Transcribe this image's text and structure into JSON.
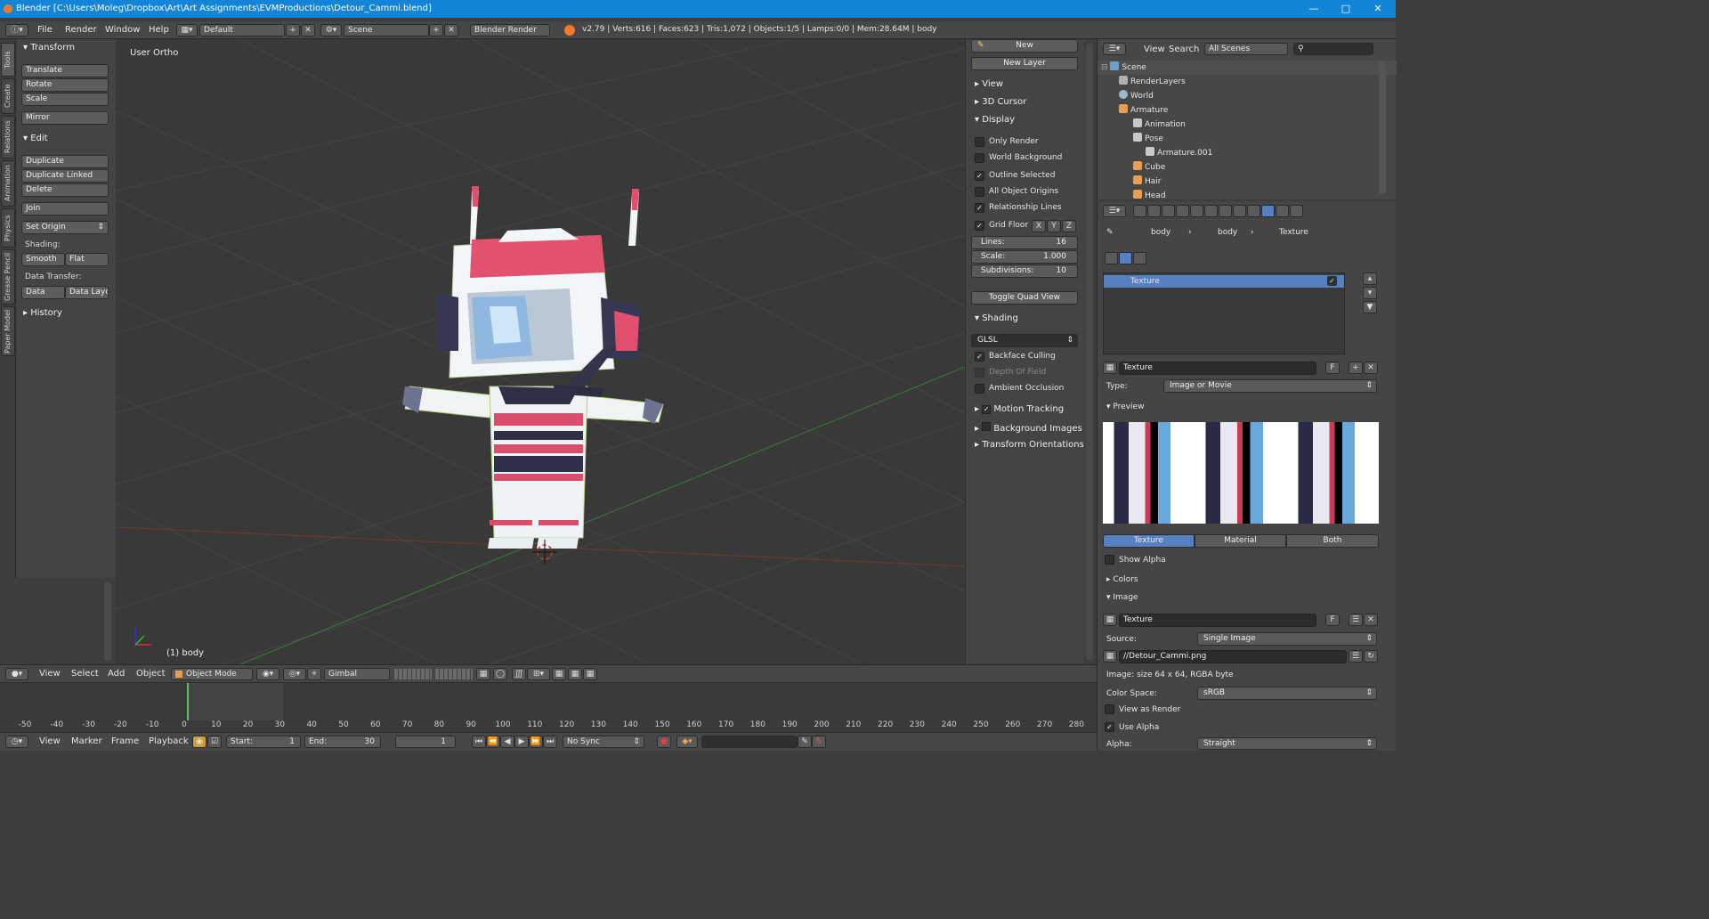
{
  "window": {
    "title": "Blender [C:\\Users\\Moleg\\Dropbox\\Art\\Art Assignments\\EVMProductions\\Detour_Cammi.blend]"
  },
  "topbar": {
    "menus": [
      "File",
      "Render",
      "Window",
      "Help"
    ],
    "layout": "Default",
    "scene": "Scene",
    "engine": "Blender Render",
    "stats": "v2.79 | Verts:616 | Faces:623 | Tris:1,072 | Objects:1/5 | Lamps:0/0 | Mem:28.64M | body"
  },
  "left_tabs": [
    "Tools",
    "Create",
    "Relations",
    "Animation",
    "Physics",
    "Grease Pencil",
    "Paper Model"
  ],
  "tool_shelf": {
    "transform_header": "Transform",
    "translate": "Translate",
    "rotate": "Rotate",
    "scale": "Scale",
    "mirror": "Mirror",
    "edit_header": "Edit",
    "duplicate": "Duplicate",
    "duplicate_linked": "Duplicate Linked",
    "delete": "Delete",
    "join": "Join",
    "set_origin": "Set Origin",
    "shading_label": "Shading:",
    "smooth": "Smooth",
    "flat": "Flat",
    "data_transfer_label": "Data Transfer:",
    "data": "Data",
    "data_layout": "Data Layo",
    "history_header": "History"
  },
  "viewport": {
    "mode_label": "User Ortho",
    "object_label": "(1) body"
  },
  "n_panel": {
    "new": "New",
    "new_layer": "New Layer",
    "view": "View",
    "cursor": "3D Cursor",
    "display": "Display",
    "only_render": "Only Render",
    "world_background": "World Background",
    "outline_selected": "Outline Selected",
    "all_object_origins": "All Object Origins",
    "relationship_lines": "Relationship Lines",
    "grid_floor": "Grid Floor",
    "x": "X",
    "y": "Y",
    "z": "Z",
    "lines_label": "Lines:",
    "lines_value": "16",
    "scale_label": "Scale:",
    "scale_value": "1.000",
    "subdiv_label": "Subdivisions:",
    "subdiv_value": "10",
    "toggle_quad": "Toggle Quad View",
    "shading": "Shading",
    "glsl": "GLSL",
    "backface_culling": "Backface Culling",
    "depth_of_field": "Depth Of Field",
    "ambient_occlusion": "Ambient Occlusion",
    "motion_tracking": "Motion Tracking",
    "background_images": "Background Images",
    "transform_orientations": "Transform Orientations"
  },
  "outliner": {
    "view": "View",
    "search": "Search",
    "filter": "All Scenes",
    "rows": [
      {
        "label": "Scene",
        "indent": 0
      },
      {
        "label": "RenderLayers",
        "indent": 1
      },
      {
        "label": "World",
        "indent": 1
      },
      {
        "label": "Armature",
        "indent": 1
      },
      {
        "label": "Animation",
        "indent": 2
      },
      {
        "label": "Pose",
        "indent": 2
      },
      {
        "label": "Armature.001",
        "indent": 2
      },
      {
        "label": "Cube",
        "indent": 2
      },
      {
        "label": "Hair",
        "indent": 2
      },
      {
        "label": "Head",
        "indent": 2
      }
    ]
  },
  "properties": {
    "breadcrumb": [
      "body",
      "body",
      "Texture"
    ],
    "slot_name": "Texture",
    "texture_name": "Texture",
    "f": "F",
    "type_label": "Type:",
    "type_value": "Image or Movie",
    "preview": "Preview",
    "seg_texture": "Texture",
    "seg_material": "Material",
    "seg_both": "Both",
    "show_alpha": "Show Alpha",
    "colors": "Colors",
    "image": "Image",
    "image_name": "Texture",
    "source_label": "Source:",
    "source_value": "Single Image",
    "filepath": "//Detour_Cammi.png",
    "image_info": "Image: size 64 x 64, RGBA byte",
    "color_space_label": "Color Space:",
    "color_space_value": "sRGB",
    "view_as_render": "View as Render",
    "use_alpha": "Use Alpha",
    "alpha_label": "Alpha:",
    "alpha_value": "Straight"
  },
  "viewport_header": {
    "menus": [
      "View",
      "Select",
      "Add",
      "Object"
    ],
    "mode": "Object Mode",
    "orientation": "Gimbal"
  },
  "timeline": {
    "ticks": [
      "-50",
      "-40",
      "-30",
      "-20",
      "-10",
      "0",
      "10",
      "20",
      "30",
      "40",
      "50",
      "60",
      "70",
      "80",
      "90",
      "100",
      "110",
      "120",
      "130",
      "140",
      "150",
      "160",
      "170",
      "180",
      "190",
      "200",
      "210",
      "220",
      "230",
      "240",
      "250",
      "260",
      "270",
      "280"
    ],
    "menus": [
      "View",
      "Marker",
      "Frame",
      "Playback"
    ],
    "start": "Start:",
    "start_value": "1",
    "end": "End:",
    "end_value": "30",
    "current": "1",
    "sync": "No Sync"
  }
}
